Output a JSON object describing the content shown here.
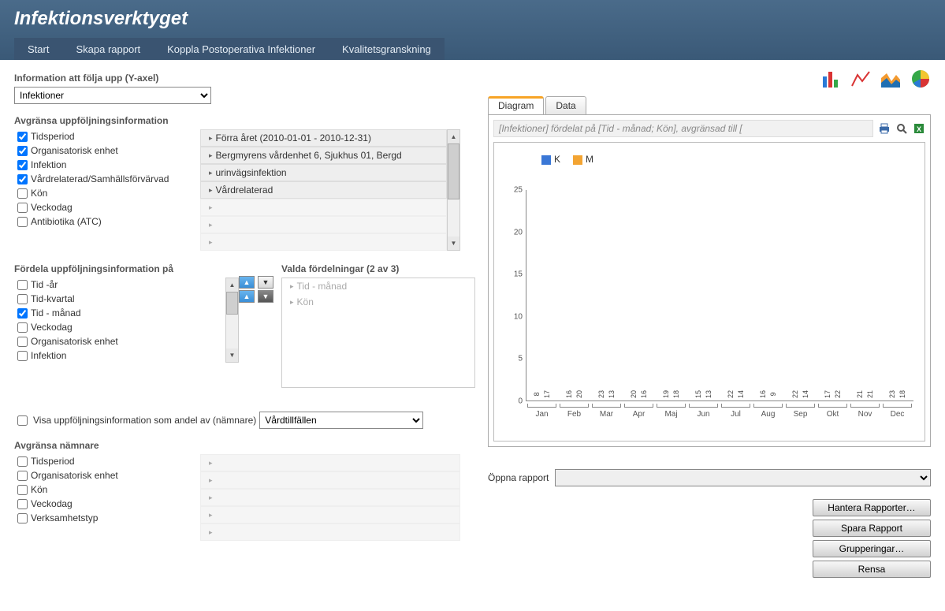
{
  "header": {
    "title": "Infektionsverktyget"
  },
  "tabs": [
    "Start",
    "Skapa rapport",
    "Koppla Postoperativa Infektioner",
    "Kvalitetsgranskning"
  ],
  "yaxis": {
    "label": "Information att följa upp (Y-axel)",
    "value": "Infektioner"
  },
  "filters_title": "Avgränsa uppföljningsinformation",
  "filters": [
    {
      "label": "Tidsperiod",
      "checked": true,
      "value": "Förra året (2010-01-01 - 2010-12-31)"
    },
    {
      "label": "Organisatorisk enhet",
      "checked": true,
      "value": "Bergmyrens vårdenhet 6, Sjukhus 01, Bergd"
    },
    {
      "label": "Infektion",
      "checked": true,
      "value": "urinvägsinfektion"
    },
    {
      "label": "Vårdrelaterad/Samhällsförvärvad",
      "checked": true,
      "value": "Vårdrelaterad"
    },
    {
      "label": "Kön",
      "checked": false,
      "value": ""
    },
    {
      "label": "Veckodag",
      "checked": false,
      "value": ""
    },
    {
      "label": "Antibiotika (ATC)",
      "checked": false,
      "value": ""
    }
  ],
  "distrib": {
    "left_title": "Fördela uppföljningsinformation på",
    "right_title": "Valda fördelningar (2 av 3)",
    "options": [
      {
        "label": "Tid -år",
        "checked": false
      },
      {
        "label": "Tid-kvartal",
        "checked": false
      },
      {
        "label": "Tid - månad",
        "checked": true
      },
      {
        "label": "Veckodag",
        "checked": false
      },
      {
        "label": "Organisatorisk enhet",
        "checked": false
      },
      {
        "label": "Infektion",
        "checked": false
      }
    ],
    "selected": [
      "Tid - månad",
      "Kön"
    ]
  },
  "andel": {
    "label": "Visa uppföljningsinformation som andel av (nämnare)",
    "value": "Vårdtillfällen"
  },
  "namnare_title": "Avgränsa nämnare",
  "namnare": [
    {
      "label": "Tidsperiod"
    },
    {
      "label": "Organisatorisk enhet"
    },
    {
      "label": "Kön"
    },
    {
      "label": "Veckodag"
    },
    {
      "label": "Verksamhetstyp"
    }
  ],
  "chart_tabs": {
    "diagram": "Diagram",
    "data": "Data"
  },
  "chart_caption": "[Infektioner] fördelat på [Tid - månad; Kön], avgränsad till [",
  "chart_data": {
    "type": "bar",
    "categories": [
      "Jan",
      "Feb",
      "Mar",
      "Apr",
      "Maj",
      "Jun",
      "Jul",
      "Aug",
      "Sep",
      "Okt",
      "Nov",
      "Dec"
    ],
    "series": [
      {
        "name": "K",
        "color": "#3a77d6",
        "values": [
          8,
          16,
          23,
          20,
          19,
          15,
          22,
          16,
          22,
          17,
          21,
          23
        ]
      },
      {
        "name": "M",
        "color": "#f3a432",
        "values": [
          17,
          20,
          13,
          16,
          18,
          13,
          14,
          9,
          14,
          22,
          21,
          18
        ]
      }
    ],
    "ylim": [
      0,
      25
    ],
    "yticks": [
      0,
      5,
      10,
      15,
      20,
      25
    ]
  },
  "open_report_label": "Öppna rapport",
  "buttons": {
    "manage": "Hantera Rapporter…",
    "save": "Spara Rapport",
    "group": "Grupperingar…",
    "clear": "Rensa"
  }
}
